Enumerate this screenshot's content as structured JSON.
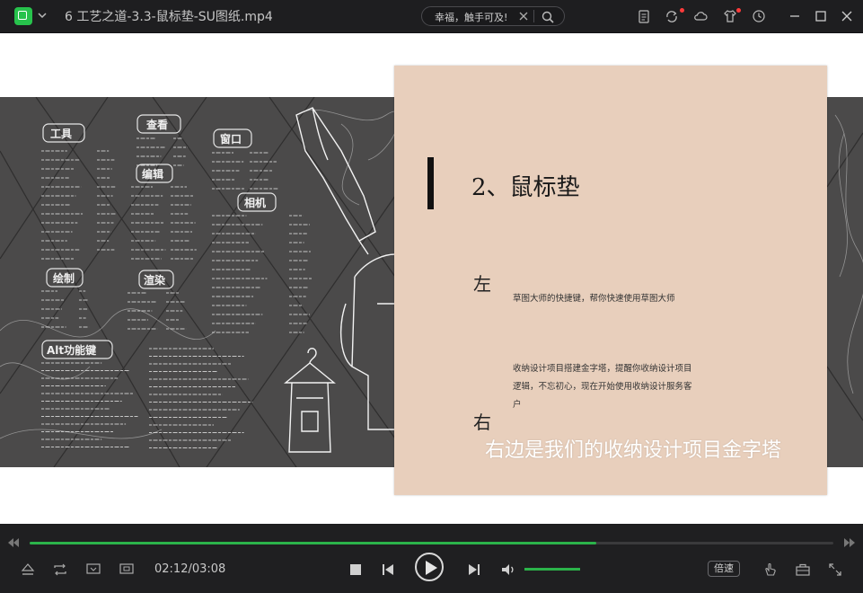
{
  "window": {
    "title": "6  工艺之道-3.3-鼠标垫-SU图纸.mp4"
  },
  "search": {
    "text": "幸福，触手可及!"
  },
  "titlebar_icons": [
    "clipboard-icon",
    "sync-icon",
    "cloud-icon",
    "shirt-icon",
    "clock-icon"
  ],
  "window_buttons": [
    "minimize-icon",
    "maximize-icon",
    "close-icon"
  ],
  "slide": {
    "heading": "2、鼠标垫",
    "left_char": "左",
    "left_text": "草图大师的快捷键，帮你快速使用草图大师",
    "right_char": "右",
    "right_text_line1": "收纳设计项目搭建金字塔，提醒你收纳设计项目",
    "right_text_line2": "逻辑，不忘初心，现在开始使用收纳设计服务客",
    "right_text_line3": "户",
    "subtitle": "右边是我们的收纳设计项目金字塔"
  },
  "chalkboard": {
    "label_tools": "工具",
    "label_view": "查看",
    "label_window": "窗口",
    "label_edit": "编辑",
    "label_camera": "相机",
    "label_draw": "绘制",
    "label_render": "渲染",
    "label_alt": "Alt功能键"
  },
  "player": {
    "current_time": "02:12",
    "total_time": "03:08",
    "time_display": "02:12/03:08",
    "progress": 0.705,
    "volume": 1.0,
    "speed_label": "倍速"
  },
  "colors": {
    "accent": "#2bb34a",
    "card": "#e8cfbc",
    "chalkboard": "#4b4a4a"
  }
}
